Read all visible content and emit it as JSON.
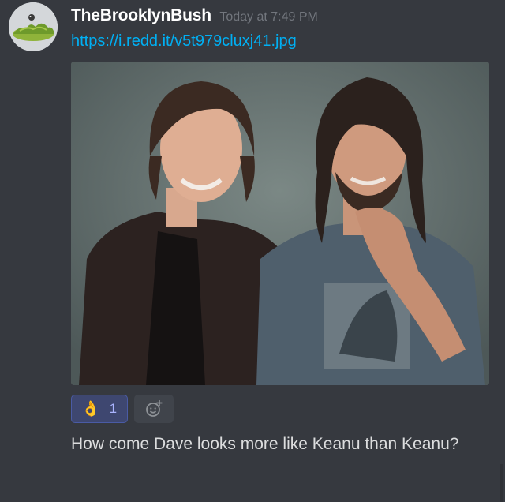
{
  "author": {
    "username": "TheBrooklynBush",
    "timestamp": "Today at 7:49 PM"
  },
  "message": {
    "link": "https://i.redd.it/v5t979cluxj41.jpg",
    "text": "How come Dave looks more like Keanu than Keanu?"
  },
  "reactions": [
    {
      "emoji": "👌",
      "count": "1",
      "active": true
    }
  ],
  "icons": {
    "avatar": "avatar-icon",
    "add_reaction": "add-reaction-icon"
  },
  "colors": {
    "background": "#36393f",
    "username": "#ffffff",
    "timestamp": "#72767d",
    "link": "#00b0f4",
    "message_text": "#dcddde",
    "reaction_active_bg": "#3e4770",
    "reaction_active_border": "#4a5ba5",
    "reaction_count": "#aab4ff",
    "add_reaction_bg": "#40444b"
  }
}
